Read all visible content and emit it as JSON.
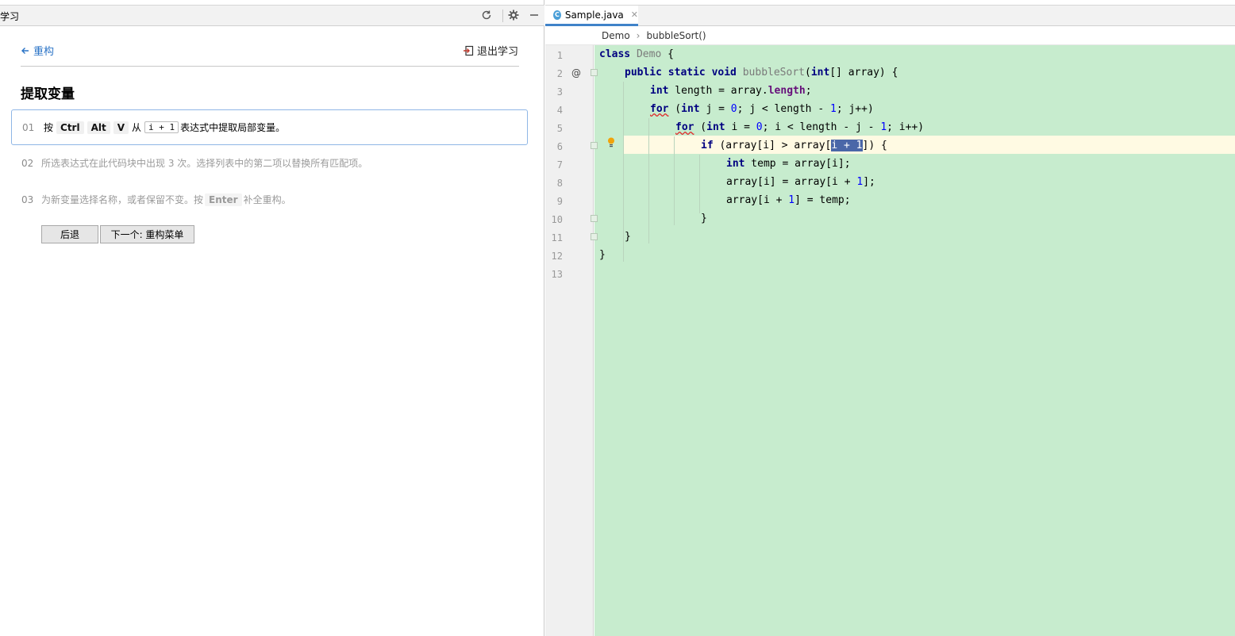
{
  "left_panel": {
    "title": "学习",
    "back_link": "重构",
    "exit_link": "退出学习",
    "lesson_title": "提取变量",
    "steps": [
      {
        "num": "01",
        "press": "按",
        "keys": [
          "Ctrl",
          "Alt",
          "V"
        ],
        "from": "从",
        "code": "i + 1",
        "rest": "表达式中提取局部变量。"
      },
      {
        "num": "02",
        "text": "所选表达式在此代码块中出现 3 次。选择列表中的第二项以替换所有匹配项。"
      },
      {
        "num": "03",
        "pre": "为新变量选择名称，或者保留不变。按",
        "key": "Enter",
        "post": "补全重构。"
      }
    ],
    "buttons": {
      "back": "后退",
      "next": "下一个: 重构菜单"
    }
  },
  "editor": {
    "tab": {
      "icon": "C",
      "label": "Sample.java"
    },
    "breadcrumb": [
      "Demo",
      "bubbleSort()"
    ],
    "line_numbers": [
      "1",
      "2",
      "3",
      "4",
      "5",
      "6",
      "7",
      "8",
      "9",
      "10",
      "11",
      "12",
      "13"
    ],
    "colors": {
      "code_bg": "#c7ecce",
      "caret_row": "#fffae3",
      "selection": "#4a67a8",
      "keyword": "#000080",
      "number": "#0000ff"
    }
  }
}
